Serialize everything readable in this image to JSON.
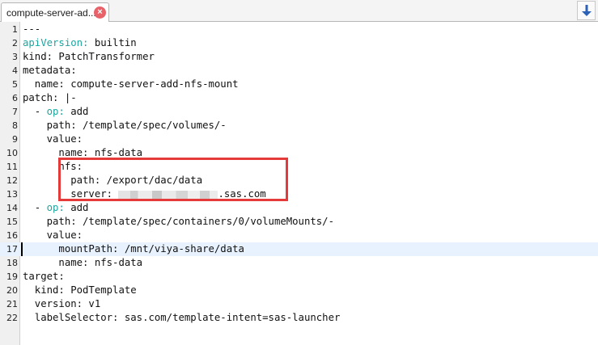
{
  "tab": {
    "title": "compute-server-ad...",
    "close_glyph": "×"
  },
  "scroll_down_icon": "arrow-down-icon",
  "editor": {
    "current_line": 17,
    "lines": [
      {
        "num": "1",
        "text": "---"
      },
      {
        "num": "2",
        "key": "apiVersion:",
        "rest": " builtin"
      },
      {
        "num": "3",
        "text": "kind: PatchTransformer"
      },
      {
        "num": "4",
        "text": "metadata:"
      },
      {
        "num": "5",
        "text": "  name: compute-server-add-nfs-mount"
      },
      {
        "num": "6",
        "text": "patch: |-"
      },
      {
        "num": "7",
        "pre": "  - ",
        "key": "op:",
        "rest": " add"
      },
      {
        "num": "8",
        "text": "    path: /template/spec/volumes/-"
      },
      {
        "num": "9",
        "text": "    value:"
      },
      {
        "num": "10",
        "text": "      name: nfs-data"
      },
      {
        "num": "11",
        "text": "      nfs:"
      },
      {
        "num": "12",
        "text": "        path: /export/dac/data"
      },
      {
        "num": "13",
        "pre": "        server: ",
        "rest": ".sas.com"
      },
      {
        "num": "14",
        "pre": "  - ",
        "key": "op:",
        "rest": " add"
      },
      {
        "num": "15",
        "text": "    path: /template/spec/containers/0/volumeMounts/-"
      },
      {
        "num": "16",
        "text": "    value:"
      },
      {
        "num": "17",
        "text": "      mountPath: /mnt/viya-share/data"
      },
      {
        "num": "18",
        "text": "      name: nfs-data"
      },
      {
        "num": "19",
        "text": "target:"
      },
      {
        "num": "20",
        "text": "  kind: PodTemplate"
      },
      {
        "num": "21",
        "text": "  version: v1"
      },
      {
        "num": "22",
        "text": "  labelSelector: sas.com/template-intent=sas-launcher"
      }
    ]
  },
  "colors": {
    "accent_key": "#1aa6a0",
    "highlight_box": "#e53a3a",
    "current_line": "#e8f2fe"
  }
}
